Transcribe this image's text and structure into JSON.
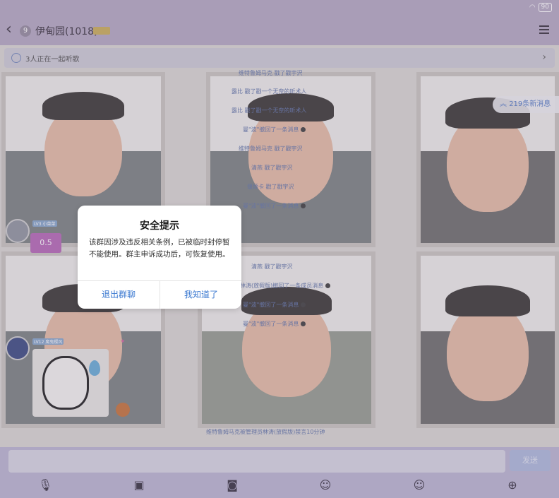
{
  "status": {
    "battery": "90"
  },
  "header": {
    "unread": "9",
    "title": "伊甸园(1018)"
  },
  "listening": {
    "text": "3人正在一起听歌"
  },
  "new_messages": "219条新消息",
  "notices": [
    "维特鲁姆马克   戳了戳宇沢",
    "露比   戳了戳一个无奈的听术人",
    "露比   戳了戳一个无奈的听术人",
    "曼\"波\"撤回了一条消息",
    "维特鲁姆马克   戳了戳宇沢",
    "清燕   戳了戳宇沢",
    "偃烦卡   戳了戳宇沢",
    "曼\"波\"撤回了一条消息",
    "清燕   戳了戳宇沢",
    "林涛(放假版)撤回了一条成员消息",
    "曼\"波\"撤回了一条消息",
    "曼\"波\"撤回了一条消息",
    "维特鲁姆马克被管理员林涛(放假版)禁言10分钟"
  ],
  "messages": [
    {
      "tag": "LV3 小菜菜",
      "bubble": "0.5"
    },
    {
      "tag": "LV12 魔鬼樱风"
    }
  ],
  "dialog": {
    "title": "安全提示",
    "body": "该群因涉及违反相关条例，已被临时封停暂不能使用。群主申诉成功后，可恢复使用。",
    "exit_label": "退出群聊",
    "ok_label": "我知道了"
  },
  "input": {
    "send_label": "发送",
    "placeholder": ""
  },
  "toolbar_icons": [
    "microphone-icon",
    "image-icon",
    "camera-icon",
    "sticker-icon",
    "emoji-icon",
    "plus-icon"
  ]
}
